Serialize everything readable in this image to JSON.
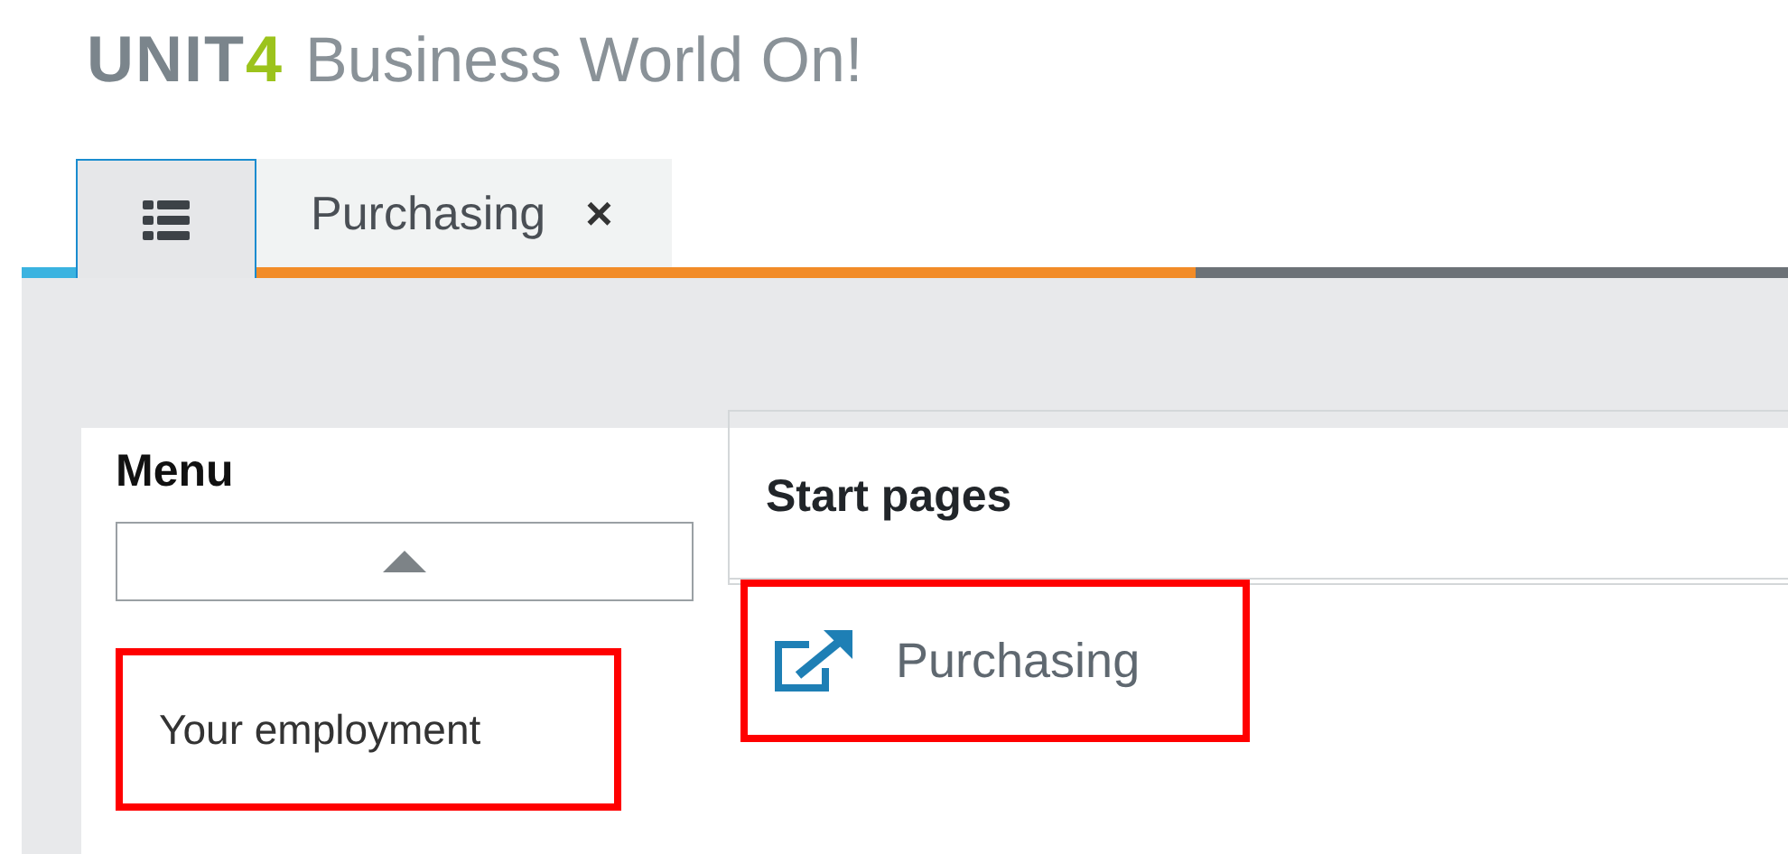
{
  "header": {
    "brand": "UNIT",
    "brand_accent": "4",
    "product": "Business World On!"
  },
  "tabs": [
    {
      "kind": "home",
      "selected": true,
      "color": "#3bb3e0"
    },
    {
      "kind": "page",
      "label": "Purchasing",
      "close": "×",
      "selected": false,
      "color": "#f28c28"
    }
  ],
  "menu": {
    "title": "Menu",
    "items": [
      {
        "label": "Your employment",
        "highlighted": true
      }
    ]
  },
  "start_pages": {
    "title": "Start pages",
    "items": [
      {
        "label": "Purchasing",
        "highlighted": true
      }
    ]
  }
}
